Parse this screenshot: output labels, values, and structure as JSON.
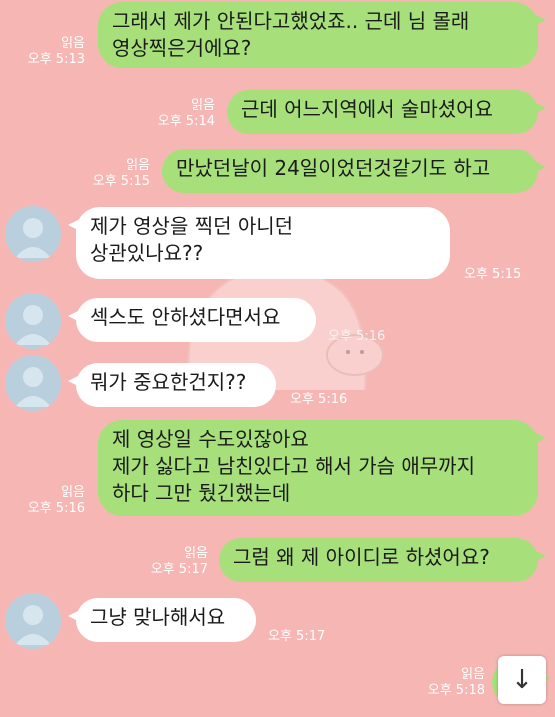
{
  "messages": [
    {
      "text": "그래서 제가 안된다고했었죠.. 근데 님 몰래\n영상찍은거에요?",
      "read": "읽음",
      "time": "오후 5:13"
    },
    {
      "text": "근데 어느지역에서 술마셨어요",
      "read": "읽음",
      "time": "오후 5:14"
    },
    {
      "text": "만났던날이 24일이었던것같기도 하고",
      "read": "읽음",
      "time": "오후 5:15"
    },
    {
      "text": "제가 영상을 찍던 아니던\n상관있나요??",
      "time": "오후 5:15"
    },
    {
      "text": "섹스도 안하셨다면서요",
      "time": "오후 5:16"
    },
    {
      "text": "뭐가 중요한건지??",
      "time": "오후 5:16"
    },
    {
      "text": "제 영상일 수도있잖아요\n제가 싫다고 남친있다고 해서 가슴 애무까지\n하다 그만 뒀긴했는데",
      "read": "읽음",
      "time": "오후 5:16"
    },
    {
      "text": "그럼 왜 제 아이디로 하셨어요?",
      "read": "읽음",
      "time": "오후 5:17"
    },
    {
      "text": "그냥 맞나해서요",
      "time": "오후 5:17"
    },
    {
      "read": "읽음",
      "time": "오후 5:18"
    }
  ],
  "icons": {
    "avatar": "default-profile-icon",
    "scroll": "arrow-down-icon"
  },
  "colors": {
    "background": "#f6b7b4",
    "outgoing": "#a7e07a",
    "incoming": "#ffffff"
  }
}
